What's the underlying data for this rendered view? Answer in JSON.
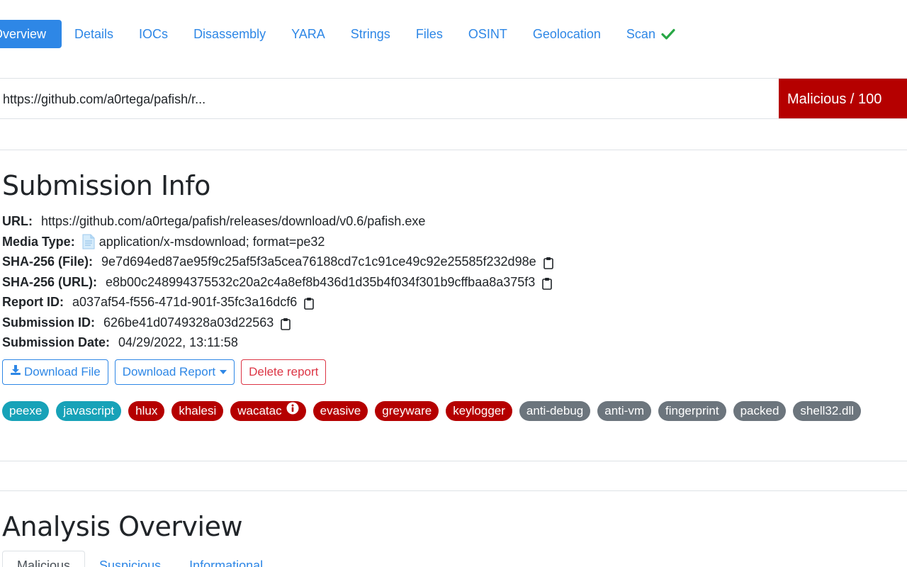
{
  "nav": {
    "tabs": [
      {
        "label": "Overview",
        "active": true
      },
      {
        "label": "Details"
      },
      {
        "label": "IOCs"
      },
      {
        "label": "Disassembly"
      },
      {
        "label": "YARA"
      },
      {
        "label": "Strings"
      },
      {
        "label": "Files"
      },
      {
        "label": "OSINT"
      },
      {
        "label": "Geolocation"
      },
      {
        "label": "Scan",
        "icon": "check-icon"
      }
    ]
  },
  "url_bar": {
    "url": "https://github.com/a0rtega/pafish/r...",
    "verdict": "Malicious / 100"
  },
  "submission": {
    "title": "Submission Info",
    "rows": [
      {
        "label": "URL:",
        "value": "https://github.com/a0rtega/pafish/releases/download/v0.6/pafish.exe"
      },
      {
        "label": "Media Type:",
        "value": "application/x-msdownload; format=pe32",
        "icon": "file-icon"
      },
      {
        "label": "SHA-256 (File):",
        "value": "9e7d694ed87ae95f9c25af5f3a5cea76188cd7c1c91ce49c92e25585f232d98e",
        "icon": "clipboard-icon"
      },
      {
        "label": "SHA-256 (URL):",
        "value": "e8b00c248994375532c20a2c4a8ef8b436d1d35b4f034f301b9cffbaa8a375f3",
        "icon": "clipboard-icon"
      },
      {
        "label": "Report ID:",
        "value": "a037af54-f556-471d-901f-35fc3a16dcf6",
        "icon": "clipboard-icon"
      },
      {
        "label": "Submission ID:",
        "value": "626be41d0749328a03d22563",
        "icon": "clipboard-icon"
      },
      {
        "label": "Submission Date:",
        "value": "04/29/2022, 13:11:58"
      }
    ],
    "buttons": {
      "download_file": "Download File",
      "download_report": "Download Report",
      "delete_report": "Delete report"
    },
    "tags": [
      {
        "label": "peexe",
        "color": "#17a2b8"
      },
      {
        "label": "javascript",
        "color": "#17a2b8"
      },
      {
        "label": "hlux",
        "color": "#b50000"
      },
      {
        "label": "khalesi",
        "color": "#b50000"
      },
      {
        "label": "wacatac",
        "color": "#b50000",
        "icon": "info-circle-icon"
      },
      {
        "label": "evasive",
        "color": "#b50000"
      },
      {
        "label": "greyware",
        "color": "#b50000"
      },
      {
        "label": "keylogger",
        "color": "#b50000"
      },
      {
        "label": "anti-debug",
        "color": "#6c757d"
      },
      {
        "label": "anti-vm",
        "color": "#6c757d"
      },
      {
        "label": "fingerprint",
        "color": "#6c757d"
      },
      {
        "label": "packed",
        "color": "#6c757d"
      },
      {
        "label": "shell32.dll",
        "color": "#6c757d"
      }
    ]
  },
  "analysis": {
    "title": "Analysis Overview",
    "tabs": [
      {
        "label": "Malicious",
        "active": true
      },
      {
        "label": "Suspicious"
      },
      {
        "label": "Informational"
      }
    ]
  },
  "colors": {
    "accent": "#2e87e6",
    "danger": "#b50000",
    "teal": "#17a2b8",
    "grey": "#6c757d",
    "success": "#28a745"
  }
}
